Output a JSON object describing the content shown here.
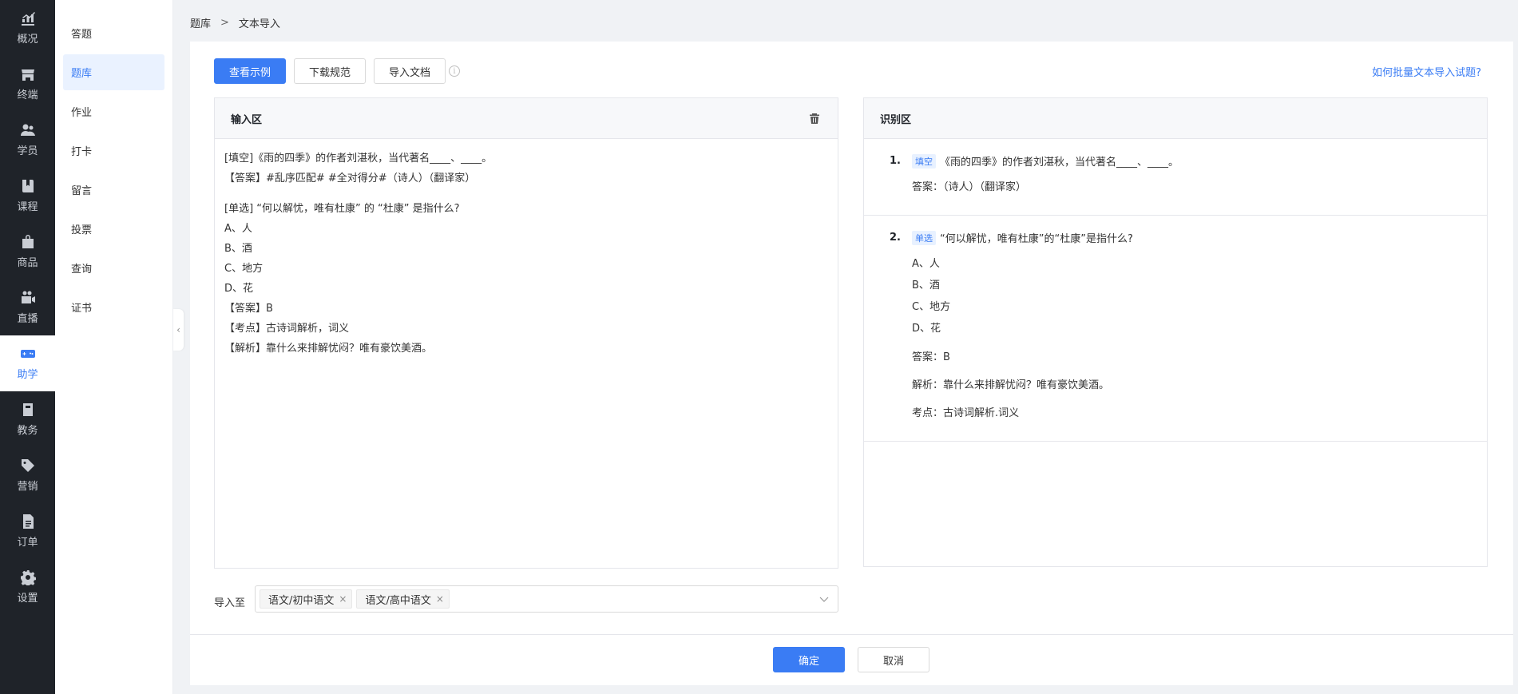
{
  "nav": [
    {
      "label": "概况",
      "icon": "chart-icon"
    },
    {
      "label": "终端",
      "icon": "store-icon"
    },
    {
      "label": "学员",
      "icon": "users-icon"
    },
    {
      "label": "课程",
      "icon": "book-icon"
    },
    {
      "label": "商品",
      "icon": "bag-icon"
    },
    {
      "label": "直播",
      "icon": "video-icon"
    },
    {
      "label": "助学",
      "icon": "gamepad-icon"
    },
    {
      "label": "教务",
      "icon": "notebook-icon"
    },
    {
      "label": "营销",
      "icon": "tag-icon"
    },
    {
      "label": "订单",
      "icon": "document-icon"
    },
    {
      "label": "设置",
      "icon": "gear-icon"
    }
  ],
  "nav_active": "助学",
  "submenu": [
    "答题",
    "题库",
    "作业",
    "打卡",
    "留言",
    "投票",
    "查询",
    "证书"
  ],
  "submenu_active": "题库",
  "breadcrumb": {
    "root": "题库",
    "sep": ">",
    "current": "文本导入"
  },
  "toolbar": {
    "view_example": "查看示例",
    "download_spec": "下载规范",
    "import_doc": "导入文档",
    "info": "i",
    "help_link": "如何批量文本导入试题?"
  },
  "input_panel": {
    "title": "输入区",
    "lines": [
      "[填空]《雨的四季》的作者刘湛秋，当代著名____、____。",
      "【答案】#乱序匹配# #全对得分#（诗人）（翻译家）",
      "[单选] “何以解忧，唯有杜康” 的 “杜康” 是指什么?",
      "A、人",
      "B、酒",
      "C、地方",
      "D、花",
      "【答案】B",
      "【考点】古诗词解析，词义",
      "【解析】靠什么来排解忧闷？唯有豪饮美酒。"
    ]
  },
  "recognize_panel": {
    "title": "识别区",
    "q1": {
      "num": "1.",
      "tag": "填空",
      "text": "《雨的四季》的作者刘湛秋，当代著名____、____。",
      "answer": "答案：（诗人）（翻译家）"
    },
    "q2": {
      "num": "2.",
      "tag": "单选",
      "text": "“何以解忧，唯有杜康”的“杜康”是指什么?",
      "options": [
        "A、人",
        "B、酒",
        "C、地方",
        "D、花"
      ],
      "answer": "答案：B",
      "analysis": "解析：靠什么来排解忧闷？唯有豪饮美酒。",
      "point": "考点：古诗词解析.词义"
    }
  },
  "import_to": {
    "label": "导入至",
    "chips": [
      "语文/初中语文",
      "语文/高中语文"
    ],
    "remove": "×"
  },
  "footer": {
    "confirm": "确定",
    "cancel": "取消"
  },
  "colors": {
    "primary": "#3a7cf4",
    "nav_bg": "#1f2329"
  }
}
